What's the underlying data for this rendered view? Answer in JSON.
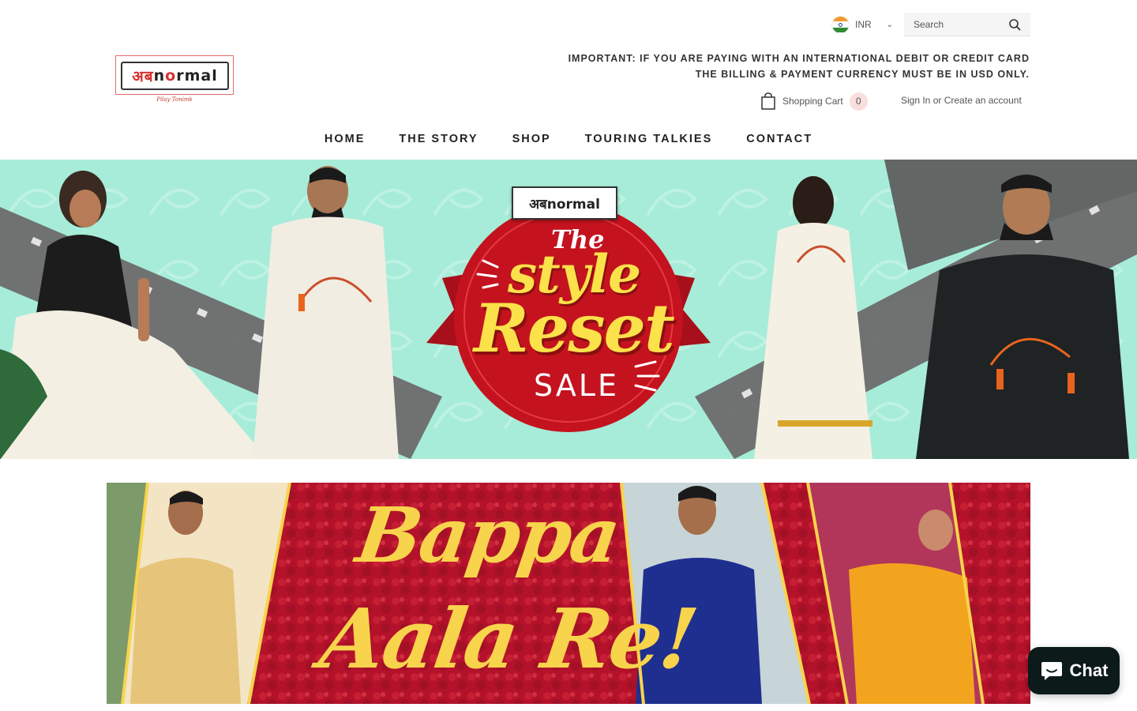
{
  "header": {
    "currency": {
      "code": "INR",
      "flag_icon": "india-flag-icon"
    },
    "search": {
      "placeholder": "Search"
    },
    "logo": {
      "text_red": "अब",
      "text_dark": "n",
      "text_red2": "o",
      "text_dark2": "rmal",
      "tagline": "Pilay Tonimk"
    },
    "notice": {
      "line1": "IMPORTANT: IF YOU ARE PAYING WITH AN INTERNATIONAL DEBIT OR CREDIT CARD",
      "line2": "THE BILLING & PAYMENT CURRENCY MUST BE IN USD ONLY."
    },
    "cart": {
      "label": "Shopping Cart",
      "count": "0"
    },
    "account": {
      "sign_in": "Sign In",
      "or": "or",
      "create": "Create an account"
    },
    "nav": [
      "HOME",
      "THE STORY",
      "SHOP",
      "TOURING TALKIES",
      "CONTACT"
    ]
  },
  "hero": {
    "logo_text": "अबnormal",
    "the": "The",
    "style": "style",
    "reset": "Reset",
    "sale": "SALE",
    "colors": {
      "bg": "#a7ecd8",
      "badge": "#c4131f",
      "yellow": "#fbe14a"
    }
  },
  "banner2": {
    "line1": "Bappa",
    "line2": "Aala Re!",
    "colors": {
      "bg": "#b3122a",
      "text": "#f7d44c"
    }
  },
  "chat": {
    "label": "Chat"
  }
}
